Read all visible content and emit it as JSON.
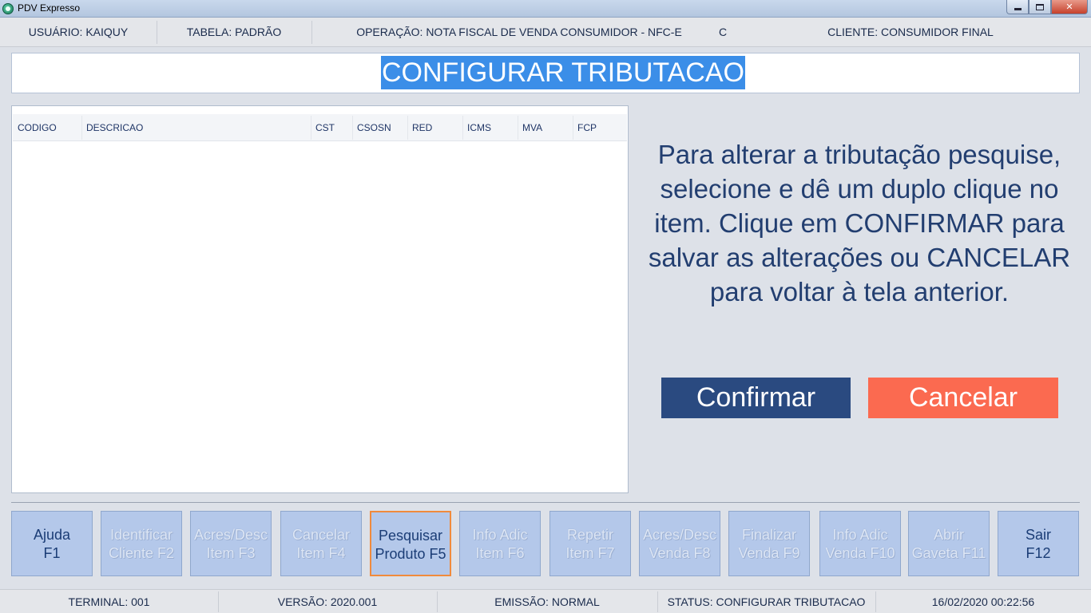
{
  "window": {
    "title": "PDV Expresso"
  },
  "infobar": {
    "usuario": "USUÁRIO: KAIQUY",
    "tabela": "TABELA: PADRÃO",
    "operacao": "OPERAÇÃO: NOTA FISCAL DE VENDA CONSUMIDOR - NFC-E",
    "extra": "C",
    "cliente": "CLIENTE: CONSUMIDOR FINAL"
  },
  "header": {
    "title": "CONFIGURAR TRIBUTACAO"
  },
  "table": {
    "columns": [
      "CODIGO",
      "DESCRICAO",
      "CST",
      "CSOSN",
      "RED",
      "ICMS",
      "MVA",
      "FCP"
    ],
    "rows": []
  },
  "message": "Para alterar a tributação pesquise, selecione e dê um duplo clique no item. Clique em CONFIRMAR para salvar as alterações ou CANCELAR para voltar à tela anterior.",
  "actions": {
    "confirm": "Confirmar",
    "cancel": "Cancelar"
  },
  "fkeys": [
    {
      "line1": "Ajuda",
      "line2": "F1",
      "enabled": true
    },
    {
      "line1": "Identificar",
      "line2": "Cliente F2",
      "enabled": false
    },
    {
      "line1": "Acres/Desc",
      "line2": "Item F3",
      "enabled": false
    },
    {
      "line1": "Cancelar",
      "line2": "Item F4",
      "enabled": false
    },
    {
      "line1": "Pesquisar",
      "line2": "Produto F5",
      "enabled": true,
      "focused": true
    },
    {
      "line1": "Info Adic",
      "line2": "Item F6",
      "enabled": false
    },
    {
      "line1": "Repetir",
      "line2": "Item F7",
      "enabled": false
    },
    {
      "line1": "Acres/Desc",
      "line2": "Venda F8",
      "enabled": false
    },
    {
      "line1": "Finalizar",
      "line2": "Venda F9",
      "enabled": false
    },
    {
      "line1": "Info Adic",
      "line2": "Venda F10",
      "enabled": false
    },
    {
      "line1": "Abrir",
      "line2": "Gaveta F11",
      "enabled": false
    },
    {
      "line1": "Sair",
      "line2": "F12",
      "enabled": true
    }
  ],
  "statusbar": {
    "terminal": "TERMINAL: 001",
    "versao": "VERSÃO: 2020.001",
    "emissao": "EMISSÃO: NORMAL",
    "status": "STATUS: CONFIGURAR TRIBUTACAO",
    "datetime": "16/02/2020 00:22:56"
  },
  "colors": {
    "accent": "#3b8ee8",
    "confirm": "#2a4a80",
    "cancel": "#fb6a50",
    "fkey_bg": "#b4c8ea",
    "fkey_focus": "#f08a3c"
  }
}
